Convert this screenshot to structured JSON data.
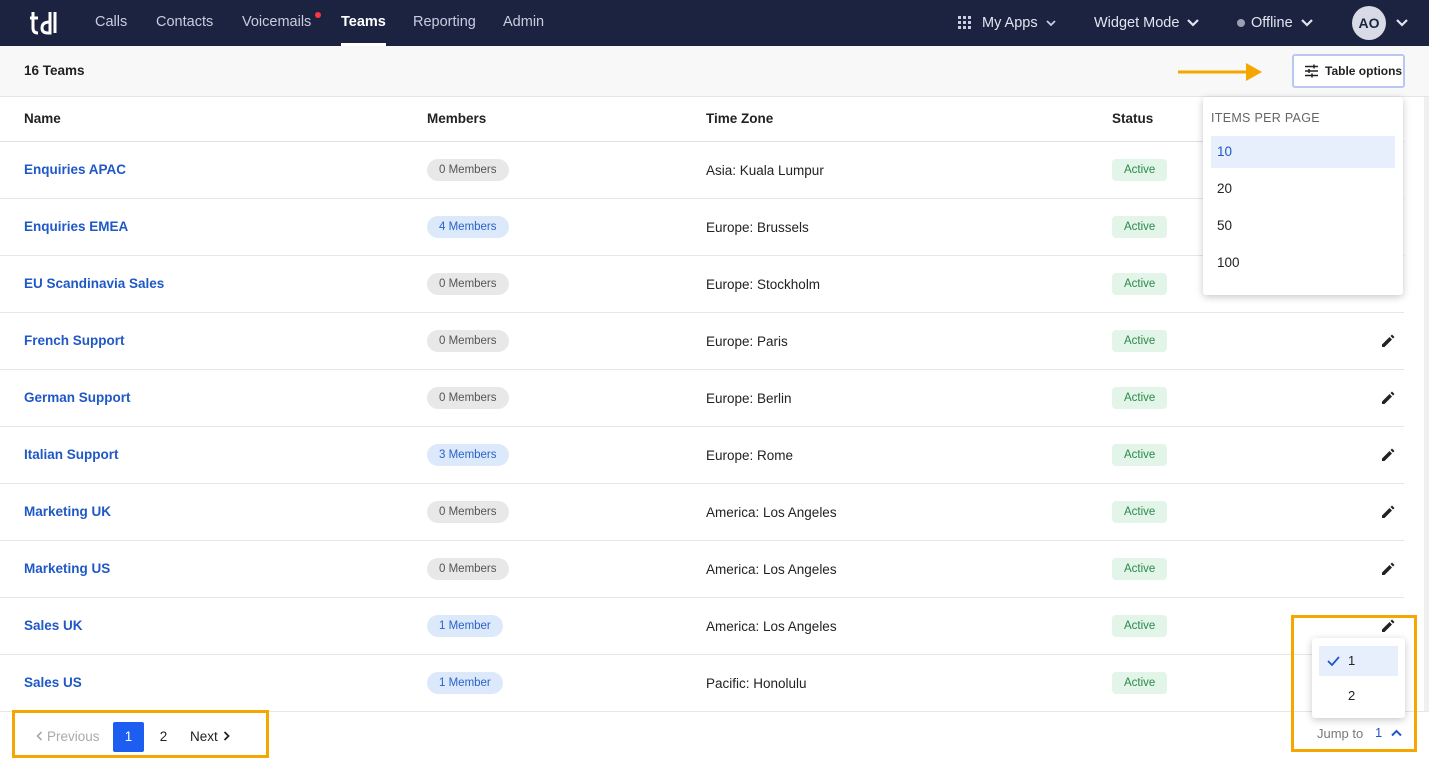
{
  "nav": {
    "logo": "tdl",
    "items": [
      {
        "label": "Calls"
      },
      {
        "label": "Contacts"
      },
      {
        "label": "Voicemails"
      },
      {
        "label": "Teams"
      },
      {
        "label": "Reporting"
      },
      {
        "label": "Admin"
      }
    ],
    "my_apps": "My Apps",
    "widget_mode": "Widget Mode",
    "status": "Offline",
    "avatar": "AO"
  },
  "header": {
    "count": "16 Teams",
    "table_options": "Table options"
  },
  "table": {
    "columns": [
      "Name",
      "Members",
      "Time Zone",
      "Status"
    ],
    "rows": [
      {
        "name": "Enquiries APAC",
        "members": "0 Members",
        "tz": "Asia: Kuala Lumpur",
        "status": "Active"
      },
      {
        "name": "Enquiries EMEA",
        "members": "4 Members",
        "tz": "Europe: Brussels",
        "status": "Active"
      },
      {
        "name": "EU Scandinavia Sales",
        "members": "0 Members",
        "tz": "Europe: Stockholm",
        "status": "Active"
      },
      {
        "name": "French Support",
        "members": "0 Members",
        "tz": "Europe: Paris",
        "status": "Active"
      },
      {
        "name": "German Support",
        "members": "0 Members",
        "tz": "Europe: Berlin",
        "status": "Active"
      },
      {
        "name": "Italian Support",
        "members": "3 Members",
        "tz": "Europe: Rome",
        "status": "Active"
      },
      {
        "name": "Marketing UK",
        "members": "0 Members",
        "tz": "America: Los Angeles",
        "status": "Active"
      },
      {
        "name": "Marketing US",
        "members": "0 Members",
        "tz": "America: Los Angeles",
        "status": "Active"
      },
      {
        "name": "Sales UK",
        "members": "1 Member",
        "tz": "America: Los Angeles",
        "status": "Active"
      },
      {
        "name": "Sales US",
        "members": "1 Member",
        "tz": "Pacific: Honolulu",
        "status": "Active"
      }
    ]
  },
  "items_per_page": {
    "title": "ITEMS PER PAGE",
    "options": [
      "10",
      "20",
      "50",
      "100"
    ],
    "selected": "10"
  },
  "pagination": {
    "previous": "Previous",
    "pages": [
      "1",
      "2"
    ],
    "current": "1",
    "next": "Next",
    "jump_label": "Jump to",
    "jump_value": "1",
    "jump_options": [
      "1",
      "2"
    ]
  },
  "colors": {
    "nav_bg": "#1c2340",
    "link": "#1f58c7",
    "accent": "#1d5ef0",
    "highlight_box": "#f5a600"
  }
}
